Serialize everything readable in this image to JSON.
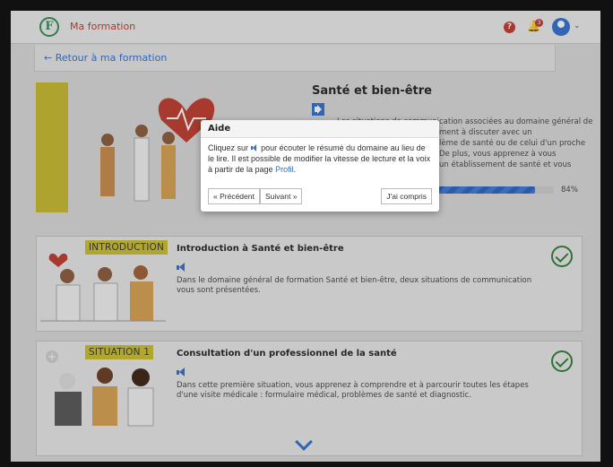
{
  "header": {
    "logo_letter": "F",
    "app_title": "Ma formation",
    "help_glyph": "?",
    "notif_count": "3"
  },
  "back_link": "← Retour à ma formation",
  "domain": {
    "title": "Santé et bien-être",
    "summary_fragments": [
      "Les situations de communication associées au domaine général de",
      "ment à discuter avec un",
      "lème de santé ou de celui d'un proche",
      "De plus, vous apprenez à vous",
      "un établissement de santé et vous"
    ],
    "progress_percent": 84,
    "progress_label": "84%"
  },
  "popup": {
    "title": "Aide",
    "text_before": "Cliquez sur",
    "text_after": "pour écouter le résumé du domaine au lieu de le lire. Il est possible de modifier la vitesse de lecture et la voix à partir de la page",
    "link": "Profil",
    "text_end": ".",
    "prev": "« Précédent",
    "next": "Suivant »",
    "done": "J'ai compris"
  },
  "cards": [
    {
      "tag": "INTRODUCTION",
      "title": "Introduction à Santé et bien-être",
      "description": "Dans le domaine général de formation Santé et bien-être, deux situations de communication vous sont présentées."
    },
    {
      "tag": "SITUATION 1",
      "title": "Consultation d'un professionnel de la santé",
      "description": "Dans cette première situation, vous apprenez à comprendre et à parcourir toutes les étapes d'une visite médicale : formulaire médical, problèmes de santé et diagnostic."
    }
  ],
  "icons": [
    "help-icon",
    "bell-icon",
    "avatar-icon",
    "speaker-icon",
    "check-icon",
    "chevron-down-icon",
    "plus-icon"
  ],
  "colors": {
    "accent": "#2f6fd1",
    "brand_red": "#c0392b",
    "tag_yellow": "#cbbd2d",
    "check_green": "#2e7d32"
  }
}
